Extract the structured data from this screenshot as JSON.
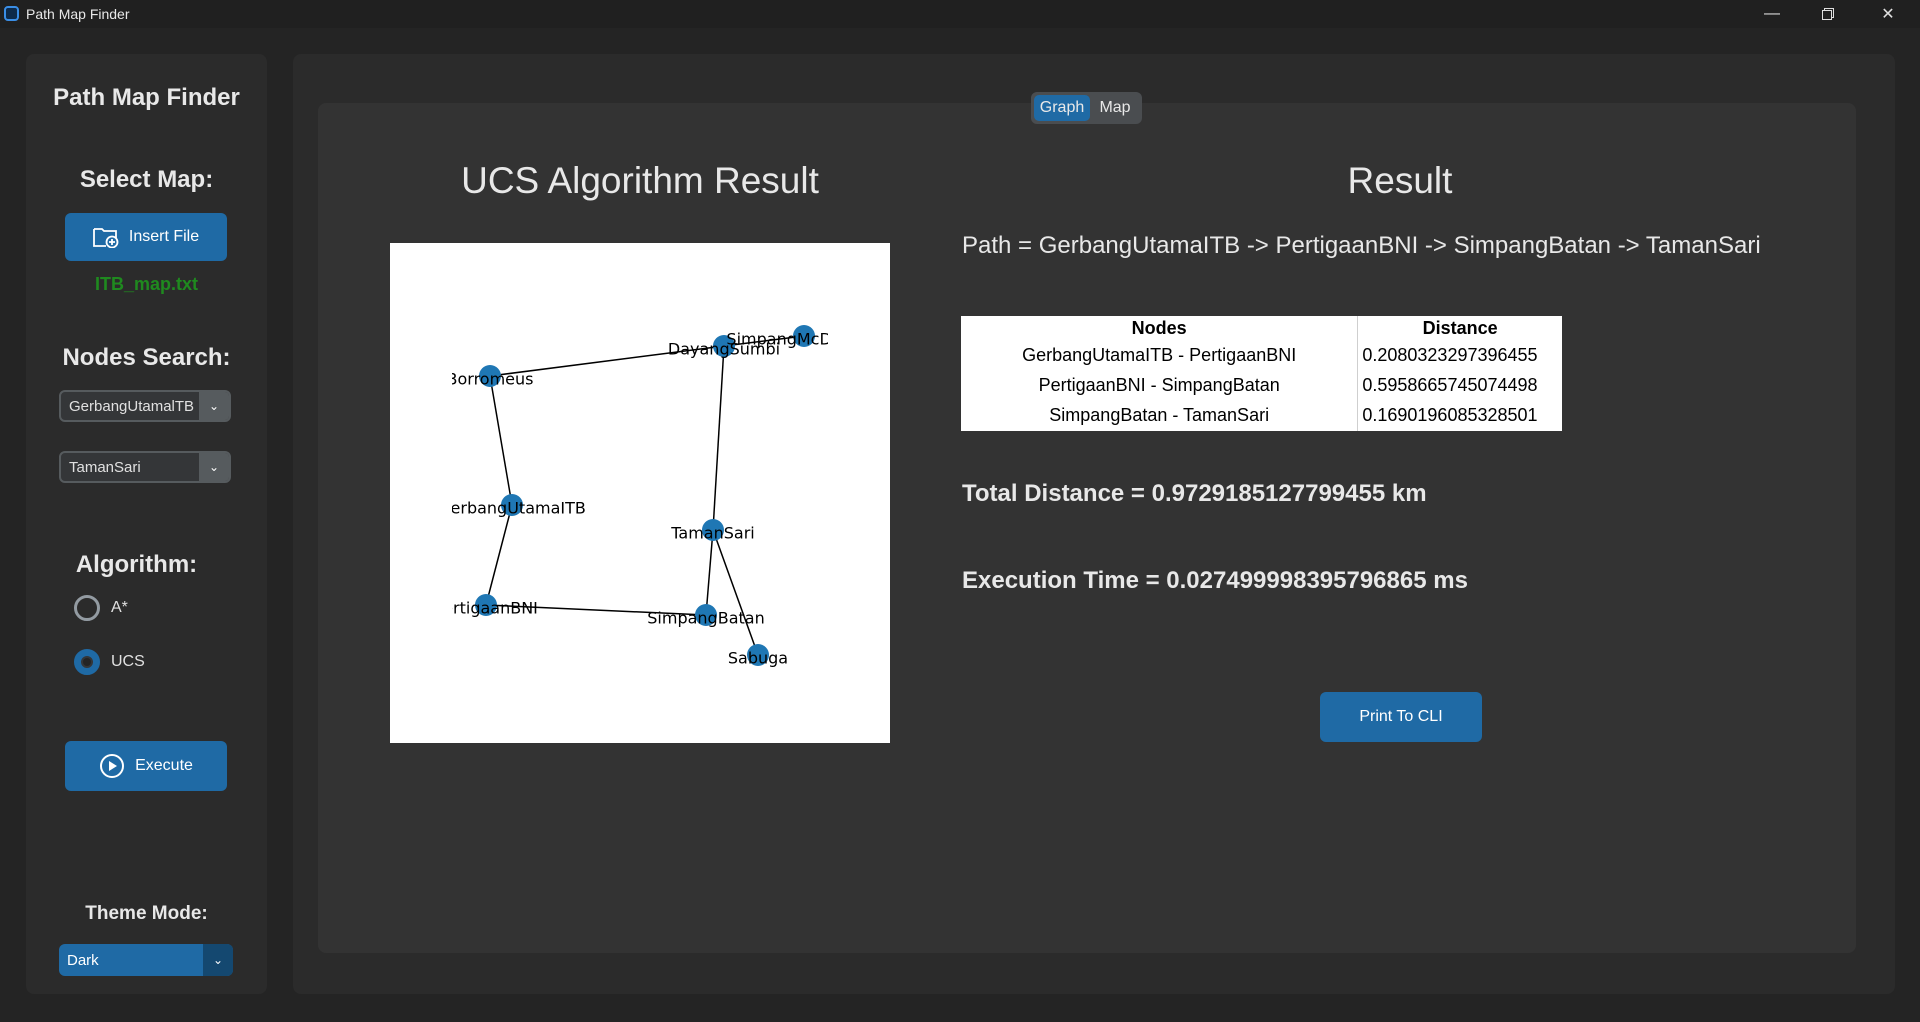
{
  "window": {
    "title": "Path Map Finder",
    "minimize_icon": "minimize-icon",
    "maximize_icon": "restore-icon",
    "close_icon": "close-icon"
  },
  "sidebar": {
    "title": "Path Map Finder",
    "select_map_label": "Select Map:",
    "insert_file_label": "Insert File",
    "file_name": "ITB_map.txt",
    "nodes_search_label": "Nodes Search:",
    "start_node": "GerbangUtamalTB",
    "end_node": "TamanSari",
    "algorithm_label": "Algorithm:",
    "algorithms": [
      {
        "label": "A*",
        "selected": false
      },
      {
        "label": "UCS",
        "selected": true
      }
    ],
    "execute_label": "Execute",
    "theme_label": "Theme Mode:",
    "theme_value": "Dark"
  },
  "tabs": [
    {
      "label": "Graph",
      "active": true
    },
    {
      "label": "Map",
      "active": false
    }
  ],
  "main": {
    "graph_title": "UCS Algorithm Result",
    "result_title": "Result",
    "path_text": "Path = GerbangUtamaITB -> PertigaanBNI -> SimpangBatan -> TamanSari",
    "table": {
      "headers": [
        "Nodes",
        "Distance"
      ],
      "rows": [
        [
          "GerbangUtamaITB - PertigaanBNI",
          "0.2080323297396455"
        ],
        [
          "PertigaanBNI - SimpangBatan",
          "0.5958665745074498"
        ],
        [
          "SimpangBatan - TamanSari",
          "0.1690196085328501"
        ]
      ]
    },
    "total_distance": "Total Distance = 0.9729185127799455 km",
    "execution_time": "Execution Time = 0.027499998395796865 ms",
    "print_button_label": "Print To CLI"
  },
  "graph": {
    "node_color": "#1f77b4",
    "nodes": [
      {
        "id": "borromeus",
        "label": "Borromeus"
      },
      {
        "id": "dayangsumbi",
        "label": "DayangSumbi"
      },
      {
        "id": "simpangmcd",
        "label": "SimpangMcDo"
      },
      {
        "id": "gerbang",
        "label": "GerbangUtamaITB"
      },
      {
        "id": "tamansari",
        "label": "TamanSari"
      },
      {
        "id": "pertigaan",
        "label": "PertigaanBNI"
      },
      {
        "id": "simpangbatan",
        "label": "SimpangBatan"
      },
      {
        "id": "sabuga",
        "label": "Sabuga"
      }
    ],
    "edges": [
      [
        "borromeus",
        "dayangsumbi"
      ],
      [
        "dayangsumbi",
        "simpangmcd"
      ],
      [
        "borromeus",
        "gerbang"
      ],
      [
        "gerbang",
        "pertigaan"
      ],
      [
        "pertigaan",
        "simpangbatan"
      ],
      [
        "simpangbatan",
        "tamansari"
      ],
      [
        "tamansari",
        "dayangsumbi"
      ],
      [
        "tamansari",
        "sabuga"
      ]
    ]
  }
}
